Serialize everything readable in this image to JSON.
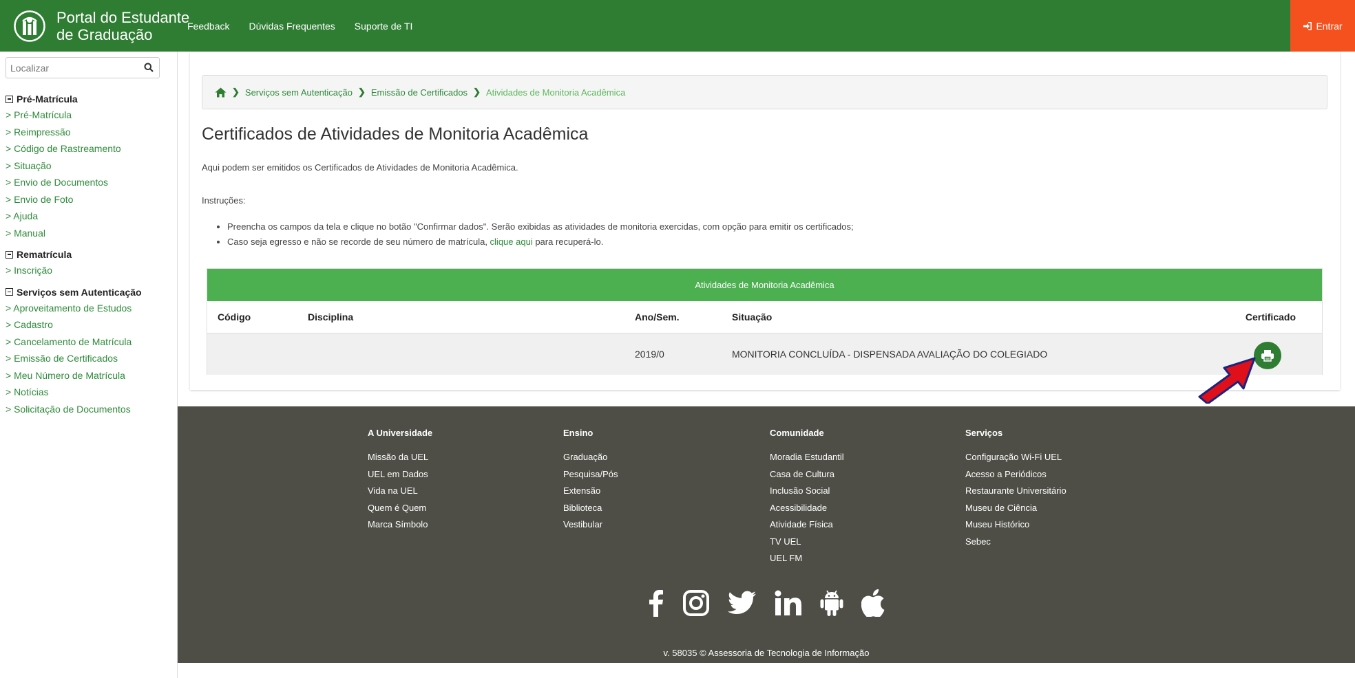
{
  "header": {
    "brand_title_line1": "Portal do Estudante",
    "brand_title_line2": "de Graduação",
    "nav": [
      "Feedback",
      "Dúvidas Frequentes",
      "Suporte de TI"
    ],
    "login_label": "Entrar",
    "colors": {
      "primary": "#2e7d32",
      "login": "#f4511e"
    }
  },
  "sidebar": {
    "search_placeholder": "Localizar",
    "sections": [
      {
        "title": "Pré-Matrícula",
        "items": [
          "> Pré-Matrícula",
          "> Reimpressão",
          "> Código de Rastreamento",
          "> Situação",
          "> Envio de Documentos",
          "> Envio de Foto",
          "> Ajuda",
          "> Manual"
        ]
      },
      {
        "title": "Rematrícula",
        "items": [
          "> Inscrição"
        ]
      },
      {
        "title": "Serviços sem Autenticação",
        "items": [
          "> Aproveitamento de Estudos",
          "> Cadastro",
          "> Cancelamento de Matrícula",
          "> Emissão de Certificados",
          "> Meu Número de Matrícula",
          "> Notícias",
          "> Solicitação de Documentos"
        ]
      }
    ]
  },
  "breadcrumb": {
    "items": [
      "Serviços sem Autenticação",
      "Emissão de Certificados",
      "Atividades de Monitoria Acadêmica"
    ]
  },
  "page": {
    "title": "Certificados de Atividades de Monitoria Acadêmica",
    "intro": "Aqui podem ser emitidos os Certificados de Atividades de Monitoria Acadêmica.",
    "instructions_label": "Instruções:",
    "instruction1": "Preencha os campos da tela e clique no botão \"Confirmar dados\". Serão exibidas as atividades de monitoria exercidas, com opção para emitir os certificados;",
    "instruction2_before": "Caso seja egresso e não se recorde de seu número de matrícula, ",
    "instruction2_link": "clique aqui",
    "instruction2_after": " para recuperá-lo."
  },
  "table": {
    "caption": "Atividades de Monitoria Acadêmica",
    "columns": [
      "Código",
      "Disciplina",
      "Ano/Sem.",
      "Situação",
      "Certificado"
    ],
    "rows": [
      {
        "codigo": "",
        "disciplina": "",
        "ano_sem": "2019/0",
        "situacao": "MONITORIA CONCLUÍDA - DISPENSADA AVALIAÇÃO DO COLEGIADO",
        "certificado_icon": "print-icon"
      }
    ]
  },
  "footer": {
    "columns": [
      {
        "title": "A Universidade",
        "links": [
          "Missão da UEL",
          "UEL em Dados",
          "Vida na UEL",
          "Quem é Quem",
          "Marca Símbolo"
        ]
      },
      {
        "title": "Ensino",
        "links": [
          "Graduação",
          "Pesquisa/Pós",
          "Extensão",
          "Biblioteca",
          "Vestibular"
        ]
      },
      {
        "title": "Comunidade",
        "links": [
          "Moradia Estudantil",
          "Casa de Cultura",
          "Inclusão Social",
          "Acessibilidade",
          "Atividade Física",
          "TV UEL",
          "UEL FM"
        ]
      },
      {
        "title": "Serviços",
        "links": [
          "Configuração Wi-Fi UEL",
          "Acesso a Periódicos",
          "Restaurante Universitário",
          "Museu de Ciência",
          "Museu Histórico",
          "Sebec"
        ]
      }
    ],
    "social_icons": [
      "facebook-icon",
      "instagram-icon",
      "twitter-icon",
      "linkedin-icon",
      "android-icon",
      "apple-icon"
    ],
    "version": "v. 58035 © Assessoria de Tecnologia de Informação",
    "background": "#4e4e46"
  }
}
